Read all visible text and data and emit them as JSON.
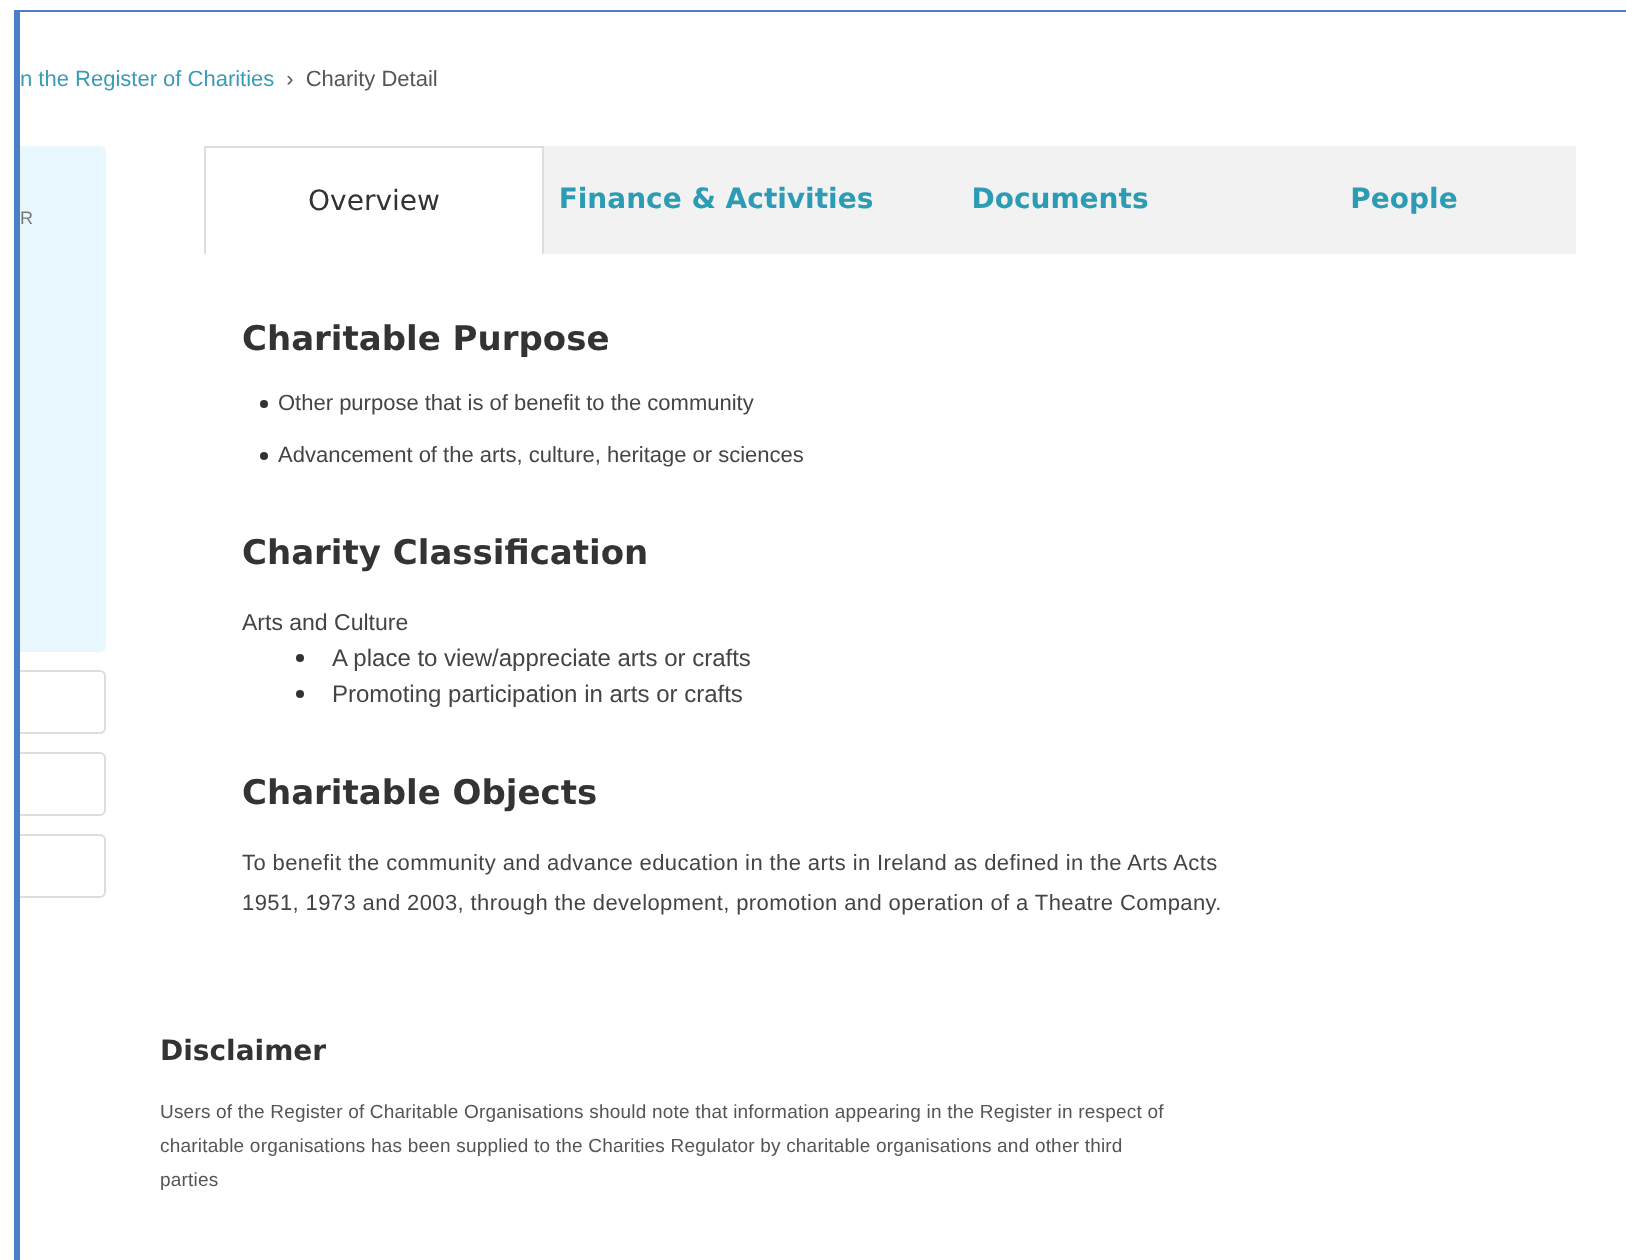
{
  "breadcrumb": {
    "link": "n the Register of Charities",
    "separator": "›",
    "current": "Charity Detail"
  },
  "sidebar": {
    "label": "R"
  },
  "tabs": [
    {
      "label": "Overview",
      "selected": true
    },
    {
      "label": "Finance & Activities",
      "selected": false
    },
    {
      "label": "Documents",
      "selected": false
    },
    {
      "label": "People",
      "selected": false
    }
  ],
  "charitable_purpose": {
    "heading": "Charitable Purpose",
    "items": [
      "Other purpose that is of benefit to the community",
      "Advancement of the arts, culture, heritage or sciences"
    ]
  },
  "classification": {
    "heading": "Charity Classification",
    "category": "Arts and Culture",
    "items": [
      "A place to view/appreciate arts or crafts",
      "Promoting participation in arts or crafts"
    ]
  },
  "objects": {
    "heading": "Charitable Objects",
    "text": "To benefit the community and advance education in the arts in Ireland as defined in the Arts Acts 1951, 1973 and 2003, through the development, promotion and operation of a Theatre Company."
  },
  "disclaimer": {
    "heading": "Disclaimer",
    "text": "Users of the Register of Charitable Organisations should note that information appearing in the Register in respect of charitable organisations has been supplied to the Charities Regulator by charitable organisations and other third parties"
  }
}
